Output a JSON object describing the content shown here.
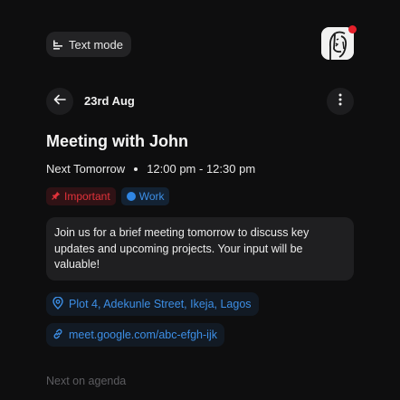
{
  "header": {
    "text_mode_label": "Text mode",
    "text_mode_icon": "text-lines-icon",
    "avatar_icon": "sketch-face-avatar",
    "notification_color": "#e5202a"
  },
  "nav": {
    "back_icon": "arrow-left-icon",
    "date": "23rd Aug",
    "more_icon": "more-vertical-icon"
  },
  "event": {
    "title": "Meeting with John",
    "day": "Next Tomorrow",
    "time": "12:00 pm - 12:30 pm",
    "tags": [
      {
        "label": "Important",
        "icon": "pin-icon",
        "color": "#e2323a"
      },
      {
        "label": "Work",
        "icon": "dot-icon",
        "color": "#2f86e4"
      }
    ],
    "description": "Join us for a brief meeting tomorrow to discuss key updates and upcoming projects. Your input will be valuable!",
    "location": "Plot 4, Adekunle Street, Ikeja, Lagos",
    "location_icon": "map-pin-icon",
    "meeting_link": "meet.google.com/abc-efgh-ijk",
    "link_icon": "link-icon"
  },
  "agenda": {
    "label": "Next on agenda"
  },
  "colors": {
    "background": "#0e0e0f",
    "accent_blue": "#3d8fe6",
    "accent_red": "#e2323a"
  }
}
